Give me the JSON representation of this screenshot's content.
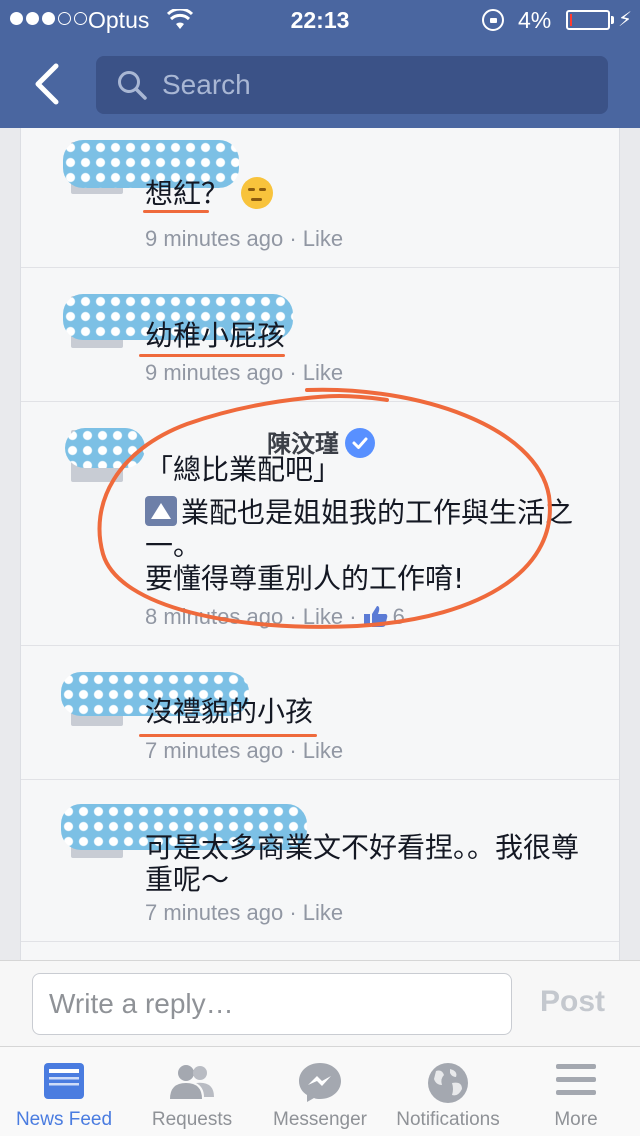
{
  "status_bar": {
    "carrier": "Optus",
    "time": "22:13",
    "battery_percent": "4%",
    "battery_level": 0.04,
    "signal_bars": 3
  },
  "nav": {
    "search_placeholder": "Search"
  },
  "comments": [
    {
      "body": "想紅？",
      "time": "9 minutes ago",
      "like": "· Like",
      "emoji": "unamused-face-icon"
    },
    {
      "body": "幼稚小屁孩",
      "time": "9 minutes ago",
      "like": "· Like"
    },
    {
      "name": "陳汶瑾",
      "quote": "「總比業配吧」",
      "body": "業配也是姐姐我的工作與生活之一。\n要懂得尊重別人的工作唷!",
      "time": "8 minutes ago",
      "like": "· Like ·",
      "like_count": "6",
      "verified": true
    },
    {
      "body": "沒禮貌的小孩",
      "time": "7 minutes ago",
      "like": "· Like"
    },
    {
      "body": "可是太多商業文不好看捏。。我很尊重呢～",
      "time": "7 minutes ago",
      "like": "· Like"
    }
  ],
  "reply": {
    "placeholder": "Write a reply…",
    "post_label": "Post"
  },
  "tabs": [
    {
      "label": "News Feed",
      "icon": "news-feed-icon",
      "active": true
    },
    {
      "label": "Requests",
      "icon": "friend-requests-icon",
      "active": false
    },
    {
      "label": "Messenger",
      "icon": "messenger-icon",
      "active": false
    },
    {
      "label": "Notifications",
      "icon": "globe-icon",
      "active": false
    },
    {
      "label": "More",
      "icon": "menu-icon",
      "active": false
    }
  ],
  "colors": {
    "header": "#4a66a0",
    "annotation": "#ef6a3c",
    "active_tab": "#4a7ce0",
    "scribble": "#7cc0e5"
  }
}
